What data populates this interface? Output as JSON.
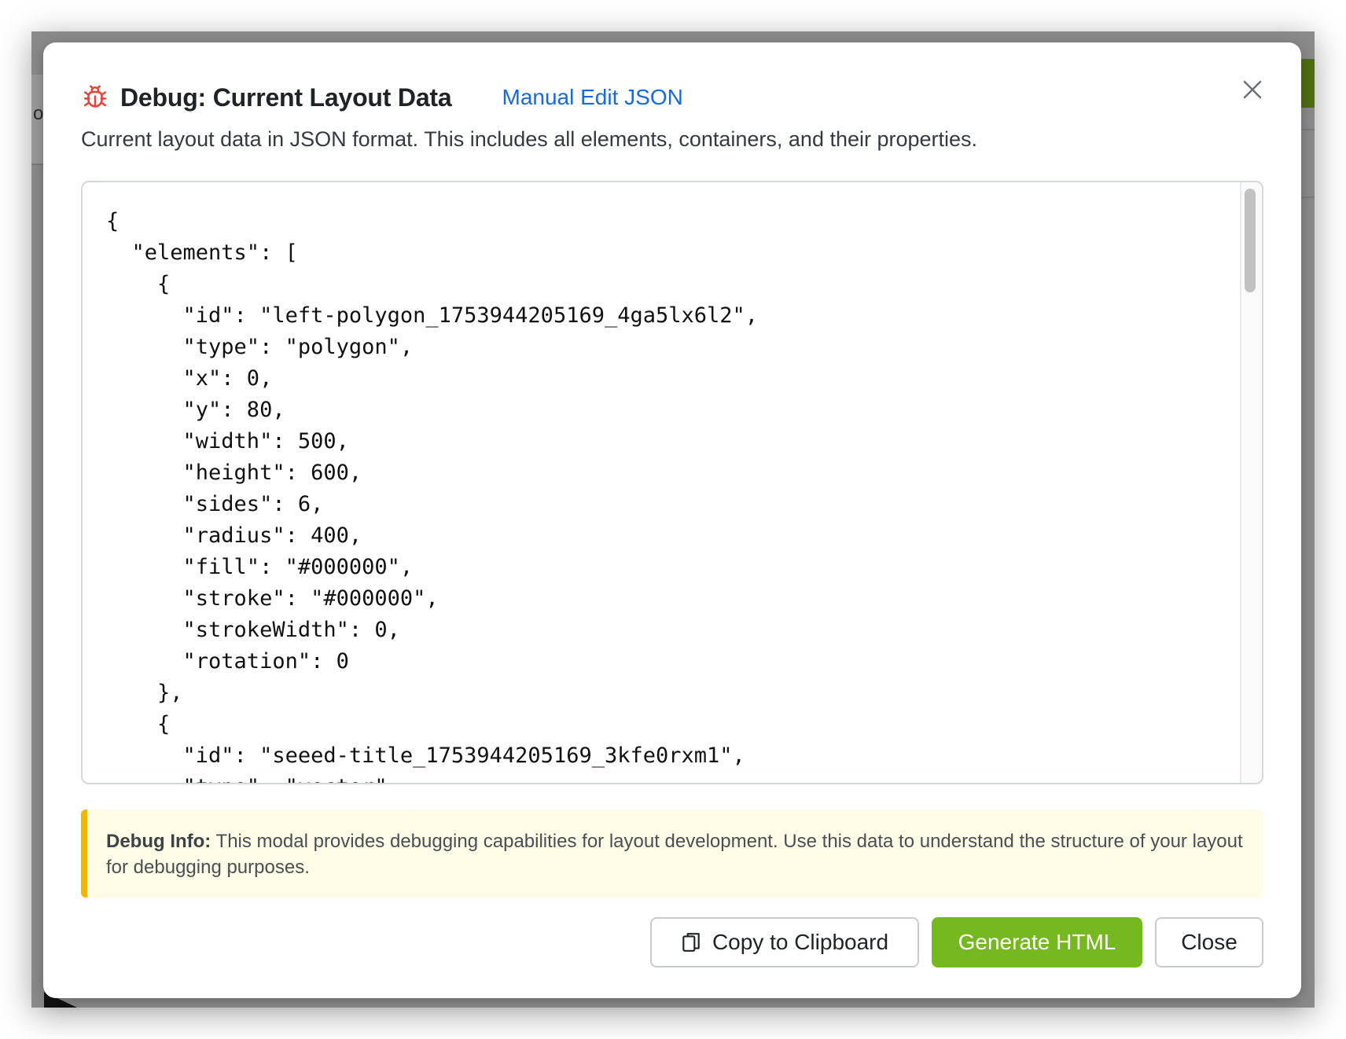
{
  "background": {
    "left_fragment": "or"
  },
  "modal": {
    "title": "Debug: Current Layout Data",
    "manual_edit_link": "Manual Edit JSON",
    "description": "Current layout data in JSON format. This includes all elements, containers, and their properties.",
    "json_text": "{\n  \"elements\": [\n    {\n      \"id\": \"left-polygon_1753944205169_4ga5lx6l2\",\n      \"type\": \"polygon\",\n      \"x\": 0,\n      \"y\": 80,\n      \"width\": 500,\n      \"height\": 600,\n      \"sides\": 6,\n      \"radius\": 400,\n      \"fill\": \"#000000\",\n      \"stroke\": \"#000000\",\n      \"strokeWidth\": 0,\n      \"rotation\": 0\n    },\n    {\n      \"id\": \"seeed-title_1753944205169_3kfe0rxm1\",\n      \"type\": \"vector\",",
    "debug_info_label": "Debug Info:",
    "debug_info_text": " This modal provides debugging capabilities for layout development. Use this data to understand the structure of your layout for debugging purposes.",
    "buttons": {
      "copy": "Copy to Clipboard",
      "generate": "Generate HTML",
      "close": "Close"
    },
    "icons": {
      "title": "bug-icon",
      "close": "close-icon",
      "copy": "clipboard-icon"
    },
    "colors": {
      "link": "#1769e0",
      "bug_icon": "#e5443a",
      "primary_button": "#76b81f",
      "info_border": "#f2b705",
      "info_background": "#fefbe6"
    }
  }
}
